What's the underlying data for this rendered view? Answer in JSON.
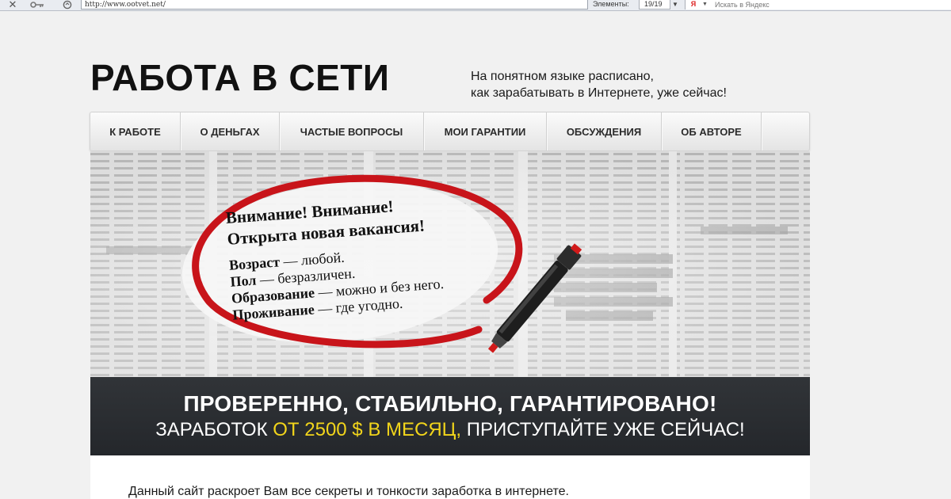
{
  "browser": {
    "url": "http://www.ootvet.net/",
    "elements_label": "Элементы:",
    "elements_count": "19/19",
    "search_placeholder": "Искать в Яндекс",
    "icons": [
      "close-icon",
      "key-icon",
      "compat-icon",
      "dropdown-icon",
      "yandex-icon"
    ]
  },
  "header": {
    "title": "РАБОТА В СЕТИ",
    "tagline_line1": "На понятном языке расписано,",
    "tagline_line2": "как зарабатывать в Интернете, уже сейчас!"
  },
  "nav": {
    "items": [
      {
        "label": "К РАБОТЕ"
      },
      {
        "label": "О ДЕНЬГАХ"
      },
      {
        "label": "ЧАСТЫЕ ВОПРОСЫ"
      },
      {
        "label": "МОИ ГАРАНТИИ"
      },
      {
        "label": "ОБСУЖДЕНИЯ"
      },
      {
        "label": "ОБ АВТОРЕ"
      }
    ]
  },
  "hero": {
    "headline1": "Внимание! Внимание!",
    "headline2": "Открыта новая вакансия!",
    "rows": [
      {
        "term": "Возраст",
        "value": " — любой."
      },
      {
        "term": "Пол",
        "value": " — безразличен."
      },
      {
        "term": "Образование",
        "value": " — можно и без него."
      },
      {
        "term": "Проживание",
        "value": " — где угодно."
      }
    ],
    "circle_color": "#c8141a",
    "marker_tip_color": "#d11a1a"
  },
  "banner": {
    "title": "ПРОВЕРЕННО, СТАБИЛЬНО, ГАРАНТИРОВАНО!",
    "sub_before": "ЗАРАБОТОК ",
    "sub_highlight": "ОТ 2500 $ В МЕСЯЦ,",
    "sub_after": " ПРИСТУПАЙТЕ УЖЕ СЕЙЧАС!",
    "highlight_color": "#f2d51b"
  },
  "content": {
    "intro": "Данный сайт раскроет Вам все секреты и тонкости заработка в интернете."
  }
}
